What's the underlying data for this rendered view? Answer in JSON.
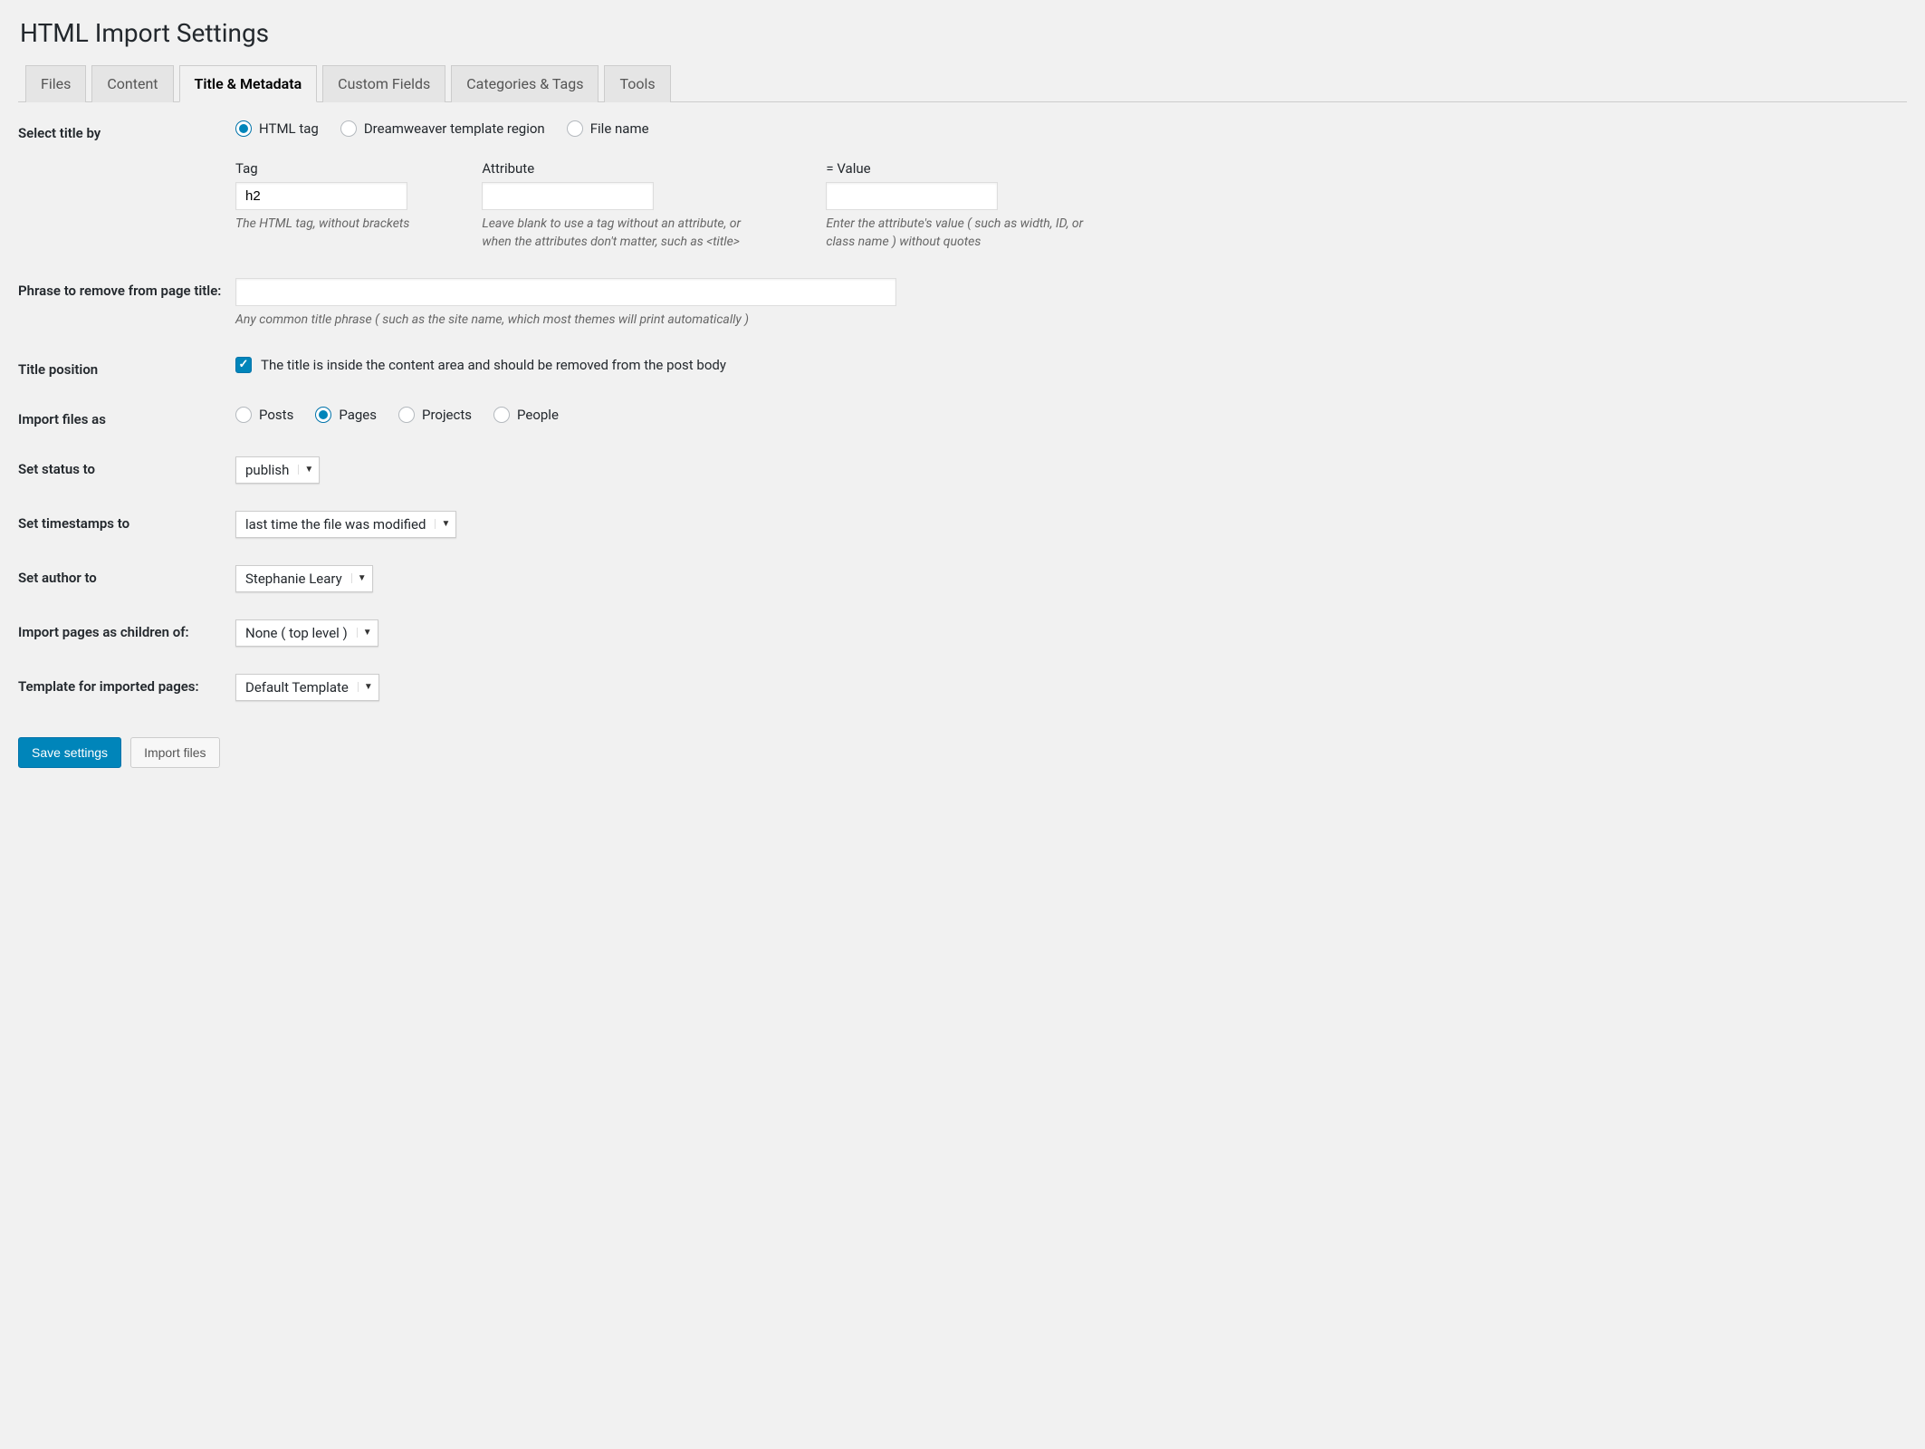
{
  "page_title": "HTML Import Settings",
  "tabs": {
    "files": "Files",
    "content": "Content",
    "title_metadata": "Title & Metadata",
    "custom_fields": "Custom Fields",
    "categories_tags": "Categories & Tags",
    "tools": "Tools"
  },
  "labels": {
    "select_title_by": "Select title by",
    "phrase_remove": "Phrase to remove from page title:",
    "title_position": "Title position",
    "import_files_as": "Import files as",
    "set_status": "Set status to",
    "set_timestamps": "Set timestamps to",
    "set_author": "Set author to",
    "import_pages_children": "Import pages as children of:",
    "template_imported": "Template for imported pages:"
  },
  "select_title_options": {
    "html_tag": "HTML tag",
    "dreamweaver": "Dreamweaver template region",
    "file_name": "File name"
  },
  "tag_fields": {
    "tag_label": "Tag",
    "tag_value": "h2",
    "tag_help": "The HTML tag, without brackets",
    "attribute_label": "Attribute",
    "attribute_value": "",
    "attribute_help": "Leave blank to use a tag without an attribute, or when the attributes don't matter, such as <title>",
    "value_label": "= Value",
    "value_value": "",
    "value_help": "Enter the attribute's value ( such as width, ID, or class name ) without quotes"
  },
  "phrase_remove_help": "Any common title phrase ( such as the site name, which most themes will print automatically )",
  "phrase_remove_value": "",
  "title_position_label": "The title is inside the content area and should be removed from the post body",
  "import_as_options": {
    "posts": "Posts",
    "pages": "Pages",
    "projects": "Projects",
    "people": "People"
  },
  "selects": {
    "status": "publish",
    "timestamps": "last time the file was modified",
    "author": "Stephanie Leary",
    "children_of": "None ( top level )",
    "template": "Default Template"
  },
  "buttons": {
    "save": "Save settings",
    "import": "Import files"
  }
}
